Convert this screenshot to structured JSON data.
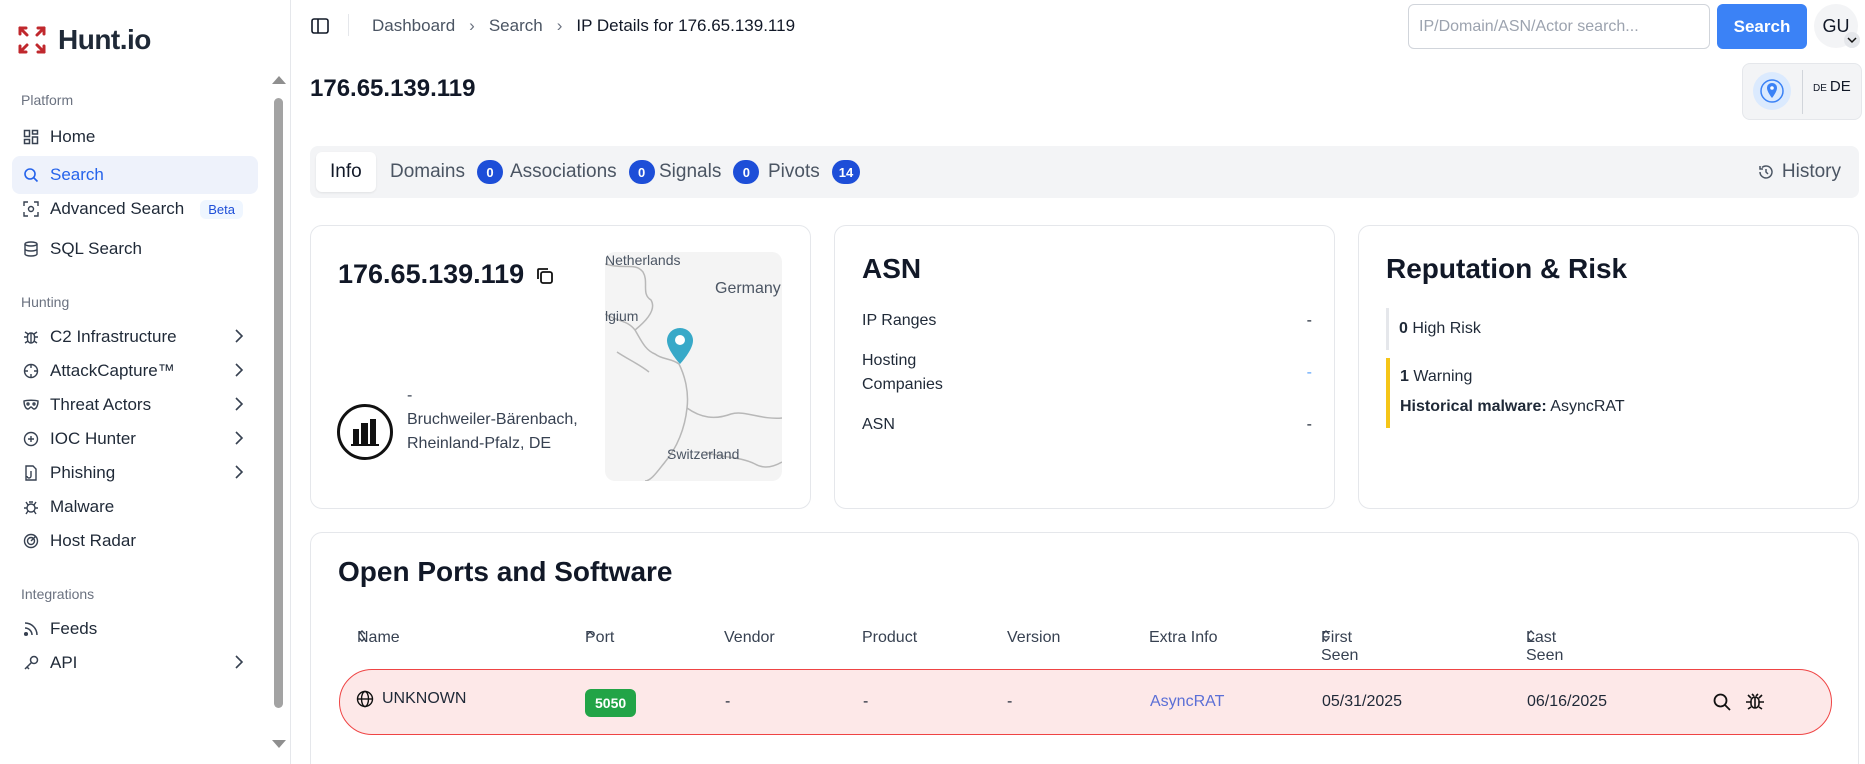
{
  "app": {
    "name": "Hunt.io"
  },
  "sidebar": {
    "sections": [
      {
        "label": "Platform"
      },
      {
        "label": "Hunting"
      },
      {
        "label": "Integrations"
      }
    ],
    "items": [
      {
        "label": "Home",
        "icon": "dashboard-grid-icon"
      },
      {
        "label": "Search",
        "icon": "search-icon",
        "active": true
      },
      {
        "label": "Advanced Search",
        "icon": "scan-icon",
        "badge": "Beta"
      },
      {
        "label": "SQL Search",
        "icon": "database-icon"
      },
      {
        "label": "C2 Infrastructure",
        "icon": "bug-icon",
        "has_children": true
      },
      {
        "label": "AttackCapture™",
        "icon": "crosshair-icon",
        "has_children": true
      },
      {
        "label": "Threat Actors",
        "icon": "mask-icon",
        "has_children": true
      },
      {
        "label": "IOC Hunter",
        "icon": "plus-circle-icon",
        "has_children": true
      },
      {
        "label": "Phishing",
        "icon": "file-hook-icon",
        "has_children": true
      },
      {
        "label": "Malware",
        "icon": "bug-icon"
      },
      {
        "label": "Host Radar",
        "icon": "radar-icon"
      },
      {
        "label": "Feeds",
        "icon": "rss-icon"
      },
      {
        "label": "API",
        "icon": "key-icon",
        "has_children": true
      }
    ]
  },
  "topbar": {
    "breadcrumbs": [
      "Dashboard",
      "Search",
      "IP Details for 176.65.139.119"
    ],
    "search_placeholder": "IP/Domain/ASN/Actor search...",
    "search_button": "Search",
    "user_initials": "GU"
  },
  "page": {
    "title": "176.65.139.119",
    "geo": {
      "flag_text": "DE",
      "country_code": "DE"
    }
  },
  "tabs": [
    {
      "label": "Info",
      "active": true
    },
    {
      "label": "Domains",
      "count": "0"
    },
    {
      "label": "Associations",
      "count": "0"
    },
    {
      "label": "Signals",
      "count": "0"
    },
    {
      "label": "Pivots",
      "count": "14"
    }
  ],
  "history_label": "History",
  "ip_card": {
    "ip": "176.65.139.119",
    "org": "-",
    "location": "Bruchweiler-Bärenbach, Rheinland-Pfalz, DE",
    "map_labels": [
      "Netherlands",
      "Germany",
      "lgium",
      "Switzerland"
    ]
  },
  "asn_card": {
    "title": "ASN",
    "rows": [
      {
        "label": "IP Ranges",
        "value": "-"
      },
      {
        "label": "Hosting Companies",
        "value": "-"
      },
      {
        "label": "ASN",
        "value": "-"
      }
    ]
  },
  "reputation": {
    "title": "Reputation & Risk",
    "high_risk_count": "0",
    "high_risk_label": "High Risk",
    "warning_count": "1",
    "warning_label": "Warning",
    "historical_label": "Historical malware:",
    "historical_value": "AsyncRAT"
  },
  "ports": {
    "title": "Open Ports and Software",
    "columns": [
      "Name",
      "Port",
      "Vendor",
      "Product",
      "Version",
      "Extra Info",
      "First Seen",
      "Last Seen"
    ],
    "rows": [
      {
        "name": "UNKNOWN",
        "port": "5050",
        "vendor": "-",
        "product": "-",
        "version": "-",
        "extra_info": "AsyncRAT",
        "first_seen": "05/31/2025",
        "last_seen": "06/16/2025"
      }
    ]
  },
  "colors": {
    "accent": "#3b82f6",
    "badge": "#1d4ed8",
    "danger_row_bg": "#fde8e8",
    "danger_border": "#ef4444",
    "warning": "#f5c518",
    "port_badge": "#22a447"
  }
}
